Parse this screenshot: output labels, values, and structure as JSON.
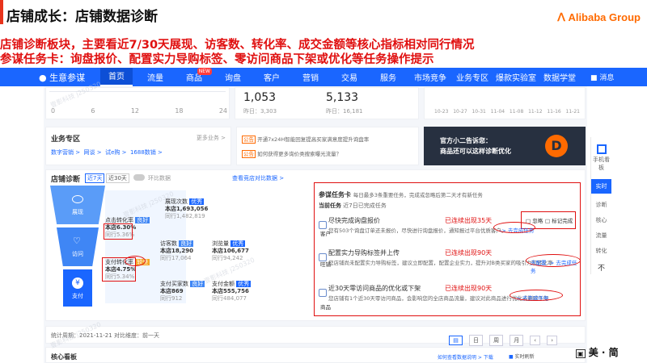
{
  "slide": {
    "title": "店铺成长：店铺数据诊断",
    "logo": "Alibaba Group",
    "line1": "店铺诊断板块，主要看近7/30天展现、访客数、转化率、成交金额等核心指标相对同行情况",
    "line2": "参谋任务卡：询盘报价、配置实力导购标签、零访问商品下架或优化等任务操作提示"
  },
  "nav": {
    "brand": "生意参谋",
    "items": [
      "首页",
      "流量",
      "商品",
      "询盘",
      "客户",
      "营销",
      "交易",
      "服务",
      "市场竞争",
      "业务专区",
      "爆款实验室",
      "数据学堂"
    ],
    "new_badge": "NEW",
    "msg": "消息"
  },
  "top": {
    "ticks": [
      "0",
      "6",
      "12",
      "18",
      "24"
    ],
    "v1": "1,053",
    "v1_sub": "昨日：3,303",
    "v2": "5,133",
    "v2_sub": "昨日：16,181",
    "dates": [
      "10-23",
      "10-27",
      "10-31",
      "11-04",
      "11-08",
      "11-12",
      "11-16",
      "11-21"
    ]
  },
  "biz": {
    "title": "业务专区",
    "more": "更多业务 >",
    "links": [
      "数字营销 >",
      "网谈 >",
      "试e购 >",
      "1688数销 >"
    ],
    "news1": "开通7x24H智能回复提高买家满意度提升询盘率",
    "news2": "如何获得更多询价类搜索曝光流量？",
    "banner1": "官方小二告诉您：",
    "banner2": "商品还可以这样诊断优化"
  },
  "diag": {
    "title": "店铺诊断",
    "tab7": "近7天",
    "tab30": "近30天",
    "compare": "环比数据",
    "link": "查看竞店对比数据 >",
    "funnel": [
      "展现",
      "访问",
      "支付"
    ],
    "m1_label": "展现次数",
    "m1_tag": "优秀",
    "m1_val": "本店1,693,056",
    "m1_peer": "同行1,482,819",
    "m2_label": "点击转化率",
    "m2_tag": "良好",
    "m2_val": "本店6.30%",
    "m2_peer": "同行5.36%",
    "m3_label": "访客数",
    "m3_tag": "良好",
    "m3_val": "本店18,290",
    "m3_peer": "同行17,064",
    "m4_label": "浏览量",
    "m4_tag": "优秀",
    "m4_val": "本店106,677",
    "m4_peer": "同行94,242",
    "m5_label": "支付转化率",
    "m5_tag": "较差",
    "m5_val": "本店4.75%",
    "m5_peer": "同行5.34%",
    "m6_label": "支付买家数",
    "m6_tag": "良好",
    "m6_val": "本店869",
    "m6_peer": "同行912",
    "m7_label": "支付金额",
    "m7_tag": "优秀",
    "m7_val": "本店555,756",
    "m7_peer": "同行484,077"
  },
  "task": {
    "title": "参谋任务卡",
    "desc": "每日最多3条重要任务，完成或忽略后第二天才有新任务",
    "current": "当前任务",
    "done": "近7日已完成任务",
    "cats": [
      "客户",
      "旺铺",
      "商品"
    ],
    "t1": "尽快完成询盘报价",
    "t1_status": "已连续出现35天",
    "t1_desc": "您有503个询盘订单还未报价，尽快进行询盘报价，通知报过平台优质客户。",
    "t1_link": "-> 去完成任务",
    "t2": "配置实力导购标签并上传",
    "t2_status": "已连续出现90天",
    "t2_desc": "您店铺尚未配置实力导购标签，建议立即配置，配置企业实力，提升对B类买家的吸引力和转化率",
    "t2_link": "去配置 -> 去完成任务",
    "t3": "近30天零访问商品的优化或下架",
    "t3_status": "已连续出现90天",
    "t3_desc": "您店铺有1个近30天零访问商品，会影响您的全店商品流量，建议对此商品进行优化或删除下架",
    "t3_link": "-> 去完成任务",
    "ignore": "忽略",
    "mark": "标记完成"
  },
  "footer": {
    "period": "统计周期：2021-11-21",
    "compare": "对比维度：前一天",
    "day": "日",
    "week": "周",
    "month": "月",
    "board": "核心看板",
    "meta": "如何查看数据说明 > 下载",
    "live": "实时刷新"
  },
  "sidebar": [
    "手机看板",
    "实时",
    "诊断",
    "核心",
    "流量",
    "转化",
    "不"
  ],
  "bottom_logo": "美 · 简"
}
